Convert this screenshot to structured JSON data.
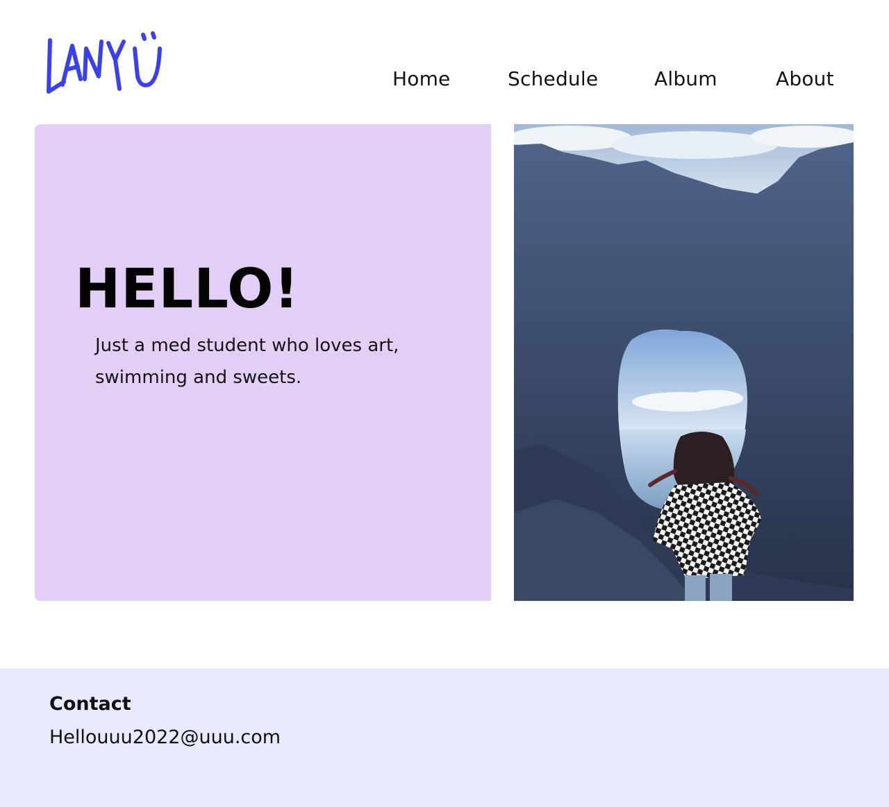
{
  "header": {
    "logo_text": "LANYU",
    "nav": [
      {
        "label": "Home"
      },
      {
        "label": "Schedule"
      },
      {
        "label": "Album"
      },
      {
        "label": "About"
      }
    ]
  },
  "hero": {
    "title": "HELLO!",
    "text": "Just a med student who loves art, swimming and sweets."
  },
  "photo": {
    "icon": "photo-image"
  },
  "footer": {
    "title": "Contact",
    "email": "Hellouuu2022@uuu.com"
  },
  "colors": {
    "logo": "#3a3ff0",
    "hero_bg": "#e3cff5",
    "footer_bg": "#e9e9fd"
  }
}
